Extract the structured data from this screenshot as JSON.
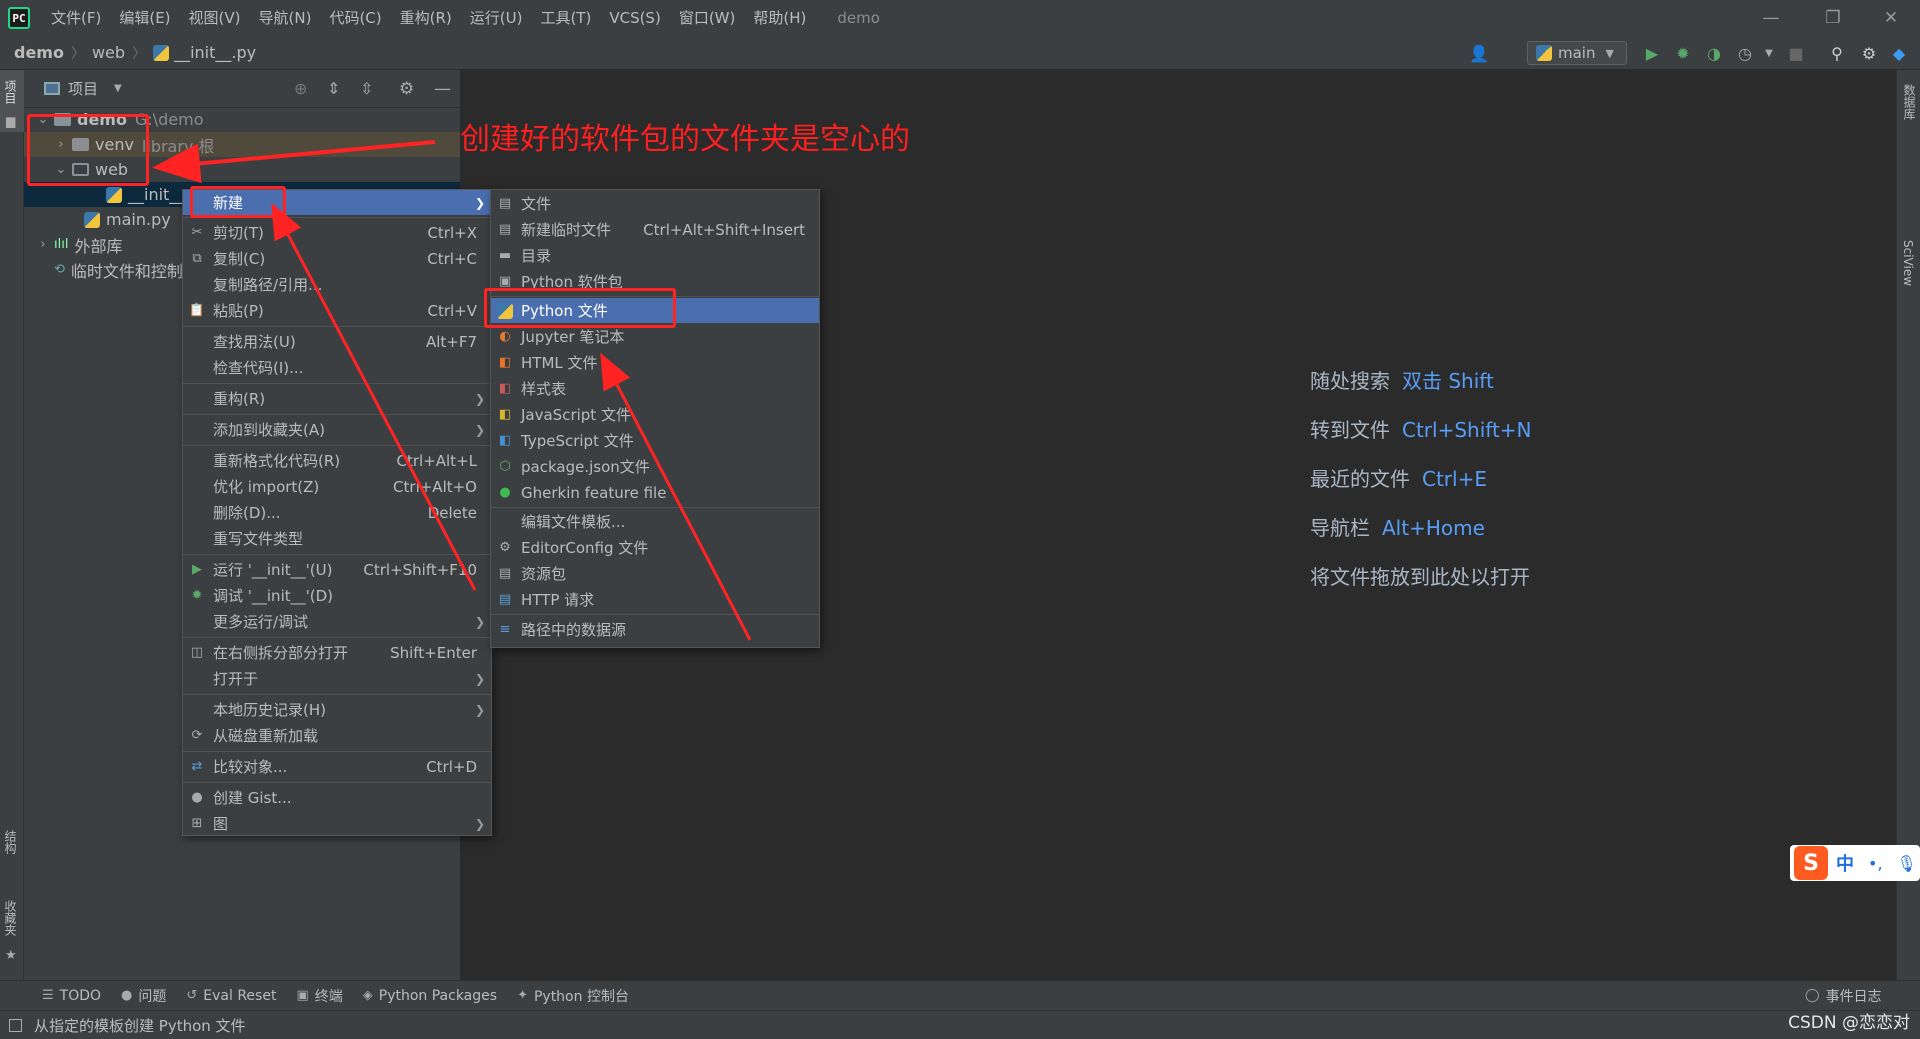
{
  "menubar": {
    "items": [
      "文件(F)",
      "编辑(E)",
      "视图(V)",
      "导航(N)",
      "代码(C)",
      "重构(R)",
      "运行(U)",
      "工具(T)",
      "VCS(S)",
      "窗口(W)",
      "帮助(H)"
    ],
    "window_title": "demo"
  },
  "navbar": {
    "crumbs": [
      "demo",
      "web",
      "__init__.py"
    ],
    "run_config": "main"
  },
  "left_strip": {
    "top_tab": "项目",
    "structure_tab": "结构",
    "favorites_tab": "收藏夹"
  },
  "right_strip": {
    "db_tab": "数据库",
    "sciview_tab": "SciView"
  },
  "project_panel": {
    "title": "项目",
    "tree": [
      {
        "name": "demo",
        "suffix": "G:\\demo"
      },
      {
        "name": "venv",
        "suffix": "library 根"
      },
      {
        "name": "web",
        "suffix": ""
      },
      {
        "name": "__init__.py",
        "suffix": ""
      },
      {
        "name": "main.py",
        "suffix": ""
      },
      {
        "name": "外部库",
        "suffix": ""
      },
      {
        "name": "临时文件和控制台",
        "suffix": ""
      }
    ]
  },
  "editor_hints": [
    {
      "label": "随处搜索",
      "key": "双击 Shift"
    },
    {
      "label": "转到文件",
      "key": "Ctrl+Shift+N"
    },
    {
      "label": "最近的文件",
      "key": "Ctrl+E"
    },
    {
      "label": "导航栏",
      "key": "Alt+Home"
    },
    {
      "label": "将文件拖放到此处以打开",
      "key": ""
    }
  ],
  "context_menu": {
    "items": [
      {
        "label": "新建",
        "shortcut": "",
        "submenu": true
      },
      {
        "label": "剪切(T)",
        "shortcut": "Ctrl+X"
      },
      {
        "label": "复制(C)",
        "shortcut": "Ctrl+C"
      },
      {
        "label": "复制路径/引用...",
        "shortcut": ""
      },
      {
        "label": "粘贴(P)",
        "shortcut": "Ctrl+V"
      },
      {
        "label": "查找用法(U)",
        "shortcut": "Alt+F7"
      },
      {
        "label": "检查代码(I)...",
        "shortcut": ""
      },
      {
        "label": "重构(R)",
        "shortcut": "",
        "submenu": true
      },
      {
        "label": "添加到收藏夹(A)",
        "shortcut": "",
        "submenu": true
      },
      {
        "label": "重新格式化代码(R)",
        "shortcut": "Ctrl+Alt+L"
      },
      {
        "label": "优化 import(Z)",
        "shortcut": "Ctrl+Alt+O"
      },
      {
        "label": "删除(D)...",
        "shortcut": "Delete"
      },
      {
        "label": "重写文件类型",
        "shortcut": ""
      },
      {
        "label": "运行 '__init__'(U)",
        "shortcut": "Ctrl+Shift+F10"
      },
      {
        "label": "调试 '__init__'(D)",
        "shortcut": ""
      },
      {
        "label": "更多运行/调试",
        "shortcut": "",
        "submenu": true
      },
      {
        "label": "在右侧拆分部分打开",
        "shortcut": "Shift+Enter"
      },
      {
        "label": "打开于",
        "shortcut": "",
        "submenu": true
      },
      {
        "label": "本地历史记录(H)",
        "shortcut": "",
        "submenu": true
      },
      {
        "label": "从磁盘重新加载",
        "shortcut": ""
      },
      {
        "label": "比较对象...",
        "shortcut": "Ctrl+D"
      },
      {
        "label": "创建 Gist...",
        "shortcut": ""
      },
      {
        "label": "图",
        "shortcut": "",
        "submenu": true
      }
    ]
  },
  "submenu": {
    "items": [
      {
        "label": "文件",
        "shortcut": ""
      },
      {
        "label": "新建临时文件",
        "shortcut": "Ctrl+Alt+Shift+Insert"
      },
      {
        "label": "目录",
        "shortcut": ""
      },
      {
        "label": "Python 软件包",
        "shortcut": ""
      },
      {
        "label": "Python 文件",
        "shortcut": ""
      },
      {
        "label": "Jupyter 笔记本",
        "shortcut": ""
      },
      {
        "label": "HTML 文件",
        "shortcut": ""
      },
      {
        "label": "样式表",
        "shortcut": ""
      },
      {
        "label": "JavaScript 文件",
        "shortcut": ""
      },
      {
        "label": "TypeScript 文件",
        "shortcut": ""
      },
      {
        "label": "package.json文件",
        "shortcut": ""
      },
      {
        "label": "Gherkin feature file",
        "shortcut": ""
      },
      {
        "label": "编辑文件模板...",
        "shortcut": ""
      },
      {
        "label": "EditorConfig 文件",
        "shortcut": ""
      },
      {
        "label": "资源包",
        "shortcut": ""
      },
      {
        "label": "HTTP 请求",
        "shortcut": ""
      },
      {
        "label": "路径中的数据源",
        "shortcut": ""
      }
    ]
  },
  "annotation": "创建好的软件包的文件夹是空心的",
  "bottom_tools": [
    "TODO",
    "问题",
    "Eval Reset",
    "终端",
    "Python Packages",
    "Python 控制台"
  ],
  "event_log": "事件日志",
  "status_text": "从指定的模板创建 Python 文件",
  "ime": {
    "label": "中"
  },
  "watermark": "CSDN @恋恋对",
  "colors": {
    "accent": "#4b6eaf",
    "annotation_red": "#ff2323",
    "link_blue": "#589df6"
  }
}
